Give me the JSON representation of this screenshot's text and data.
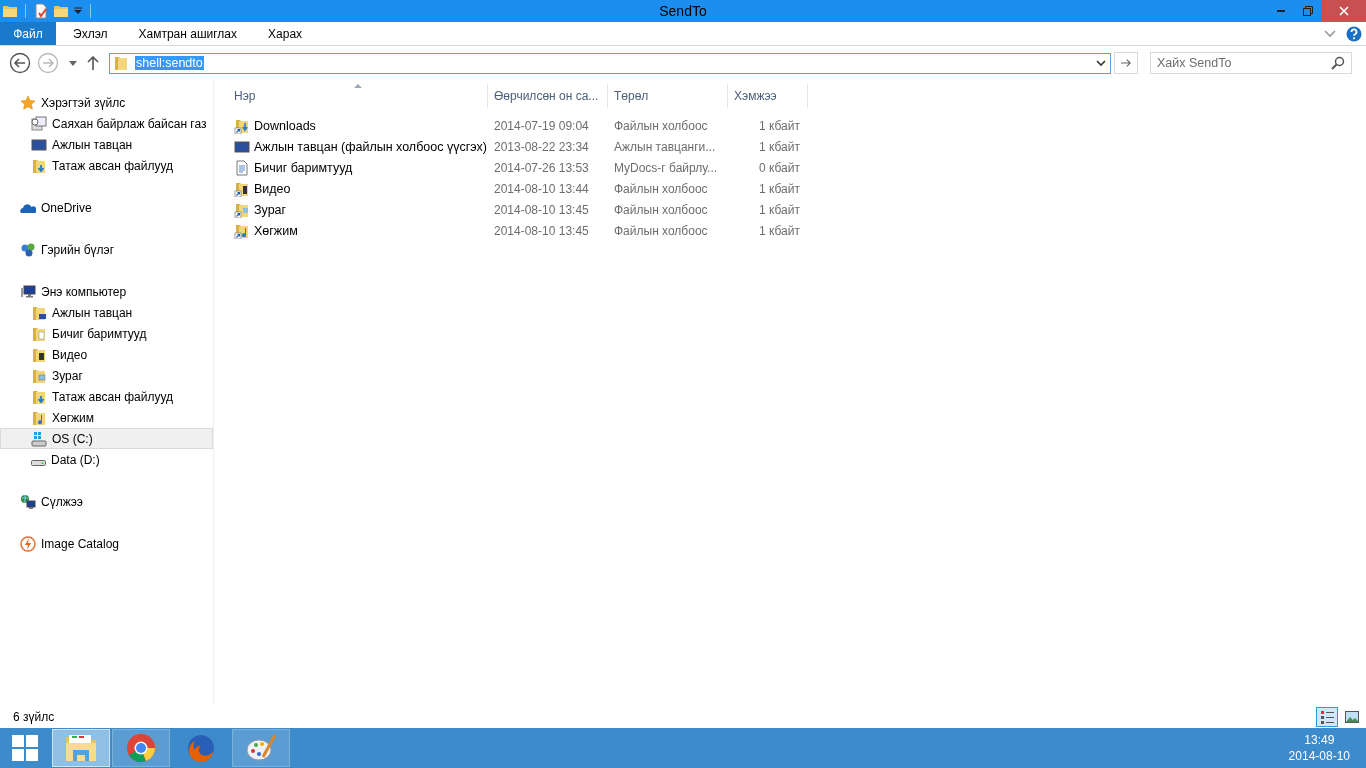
{
  "window": {
    "title": "SendTo"
  },
  "ribbon": {
    "file_button": "Файл",
    "tabs": [
      "Эхлэл",
      "Хамтран ашиглах",
      "Харах"
    ]
  },
  "address": {
    "value": "shell:sendto",
    "search_placeholder": "Хайх SendTo"
  },
  "sidebar": {
    "groups": [
      {
        "label": "Хэрэгтэй зүйлс",
        "kind": "star",
        "selected": false,
        "children": [
          {
            "label": "Саяхан байрлаж байсан газ",
            "kind": "recent",
            "selected": false
          },
          {
            "label": "Ажлын тавцан",
            "kind": "desktop",
            "selected": false
          },
          {
            "label": "Татаж авсан файлууд",
            "kind": "downloads",
            "selected": false
          }
        ]
      },
      {
        "label": "OneDrive",
        "kind": "cloud",
        "selected": false
      },
      {
        "label": "Гэрийн бүлэг",
        "kind": "homegroup",
        "selected": false
      },
      {
        "label": "Энэ компьютер",
        "kind": "computer",
        "selected": false,
        "children": [
          {
            "label": "Ажлын тавцан",
            "kind": "desktop-folder",
            "selected": false
          },
          {
            "label": "Бичиг баримтууд",
            "kind": "documents",
            "selected": false
          },
          {
            "label": "Видео",
            "kind": "videos",
            "selected": false
          },
          {
            "label": "Зураг",
            "kind": "pictures",
            "selected": false
          },
          {
            "label": "Татаж авсан файлууд",
            "kind": "downloads",
            "selected": false
          },
          {
            "label": "Хөгжим",
            "kind": "music",
            "selected": false
          },
          {
            "label": "OS (C:)",
            "kind": "os-drive",
            "selected": true
          },
          {
            "label": "Data (D:)",
            "kind": "drive",
            "selected": false
          }
        ]
      },
      {
        "label": "Сүлжээ",
        "kind": "network",
        "selected": false
      },
      {
        "label": "Image Catalog",
        "kind": "catalog",
        "selected": false
      }
    ]
  },
  "table": {
    "columns": [
      {
        "label": "Нэр",
        "sorted": true
      },
      {
        "label": "Өөрчилсөн он са...",
        "sorted": false
      },
      {
        "label": "Төрөл",
        "sorted": false
      },
      {
        "label": "Хэмжээ",
        "sorted": false
      }
    ],
    "rows": [
      {
        "kind": "downloads",
        "name": "Downloads",
        "modified": "2014-07-19 09:04",
        "type": "Файлын холбоос",
        "size": "1 кбайт"
      },
      {
        "kind": "desktop",
        "name": "Ажлын тавцан (файлын холбоос үүсгэх)",
        "modified": "2013-08-22 23:34",
        "type": "Ажлын тавцанги...",
        "size": "1 кбайт"
      },
      {
        "kind": "document",
        "name": "Бичиг баримтууд",
        "modified": "2014-07-26 13:53",
        "type": "MyDocs-г байрлу...",
        "size": "0 кбайт"
      },
      {
        "kind": "videos",
        "name": "Видео",
        "modified": "2014-08-10 13:44",
        "type": "Файлын холбоос",
        "size": "1 кбайт"
      },
      {
        "kind": "pictures",
        "name": "Зураг",
        "modified": "2014-08-10 13:45",
        "type": "Файлын холбоос",
        "size": "1 кбайт"
      },
      {
        "kind": "music",
        "name": "Хөгжим",
        "modified": "2014-08-10 13:45",
        "type": "Файлын холбоос",
        "size": "1 кбайт"
      }
    ]
  },
  "status_bar": {
    "count": "6 зүйлс",
    "views": [
      {
        "kind": "details",
        "selected": true
      },
      {
        "kind": "large-icons",
        "selected": false
      }
    ]
  },
  "taskbar": {
    "apps": [
      {
        "kind": "explorer",
        "selected": true,
        "running": true
      },
      {
        "kind": "browser-round",
        "selected": false,
        "running": true
      },
      {
        "kind": "browser-fox",
        "selected": false,
        "running": false
      },
      {
        "kind": "paint",
        "selected": false,
        "running": true
      }
    ],
    "clock": {
      "time": "13:49",
      "date": "2014-08-10"
    }
  }
}
